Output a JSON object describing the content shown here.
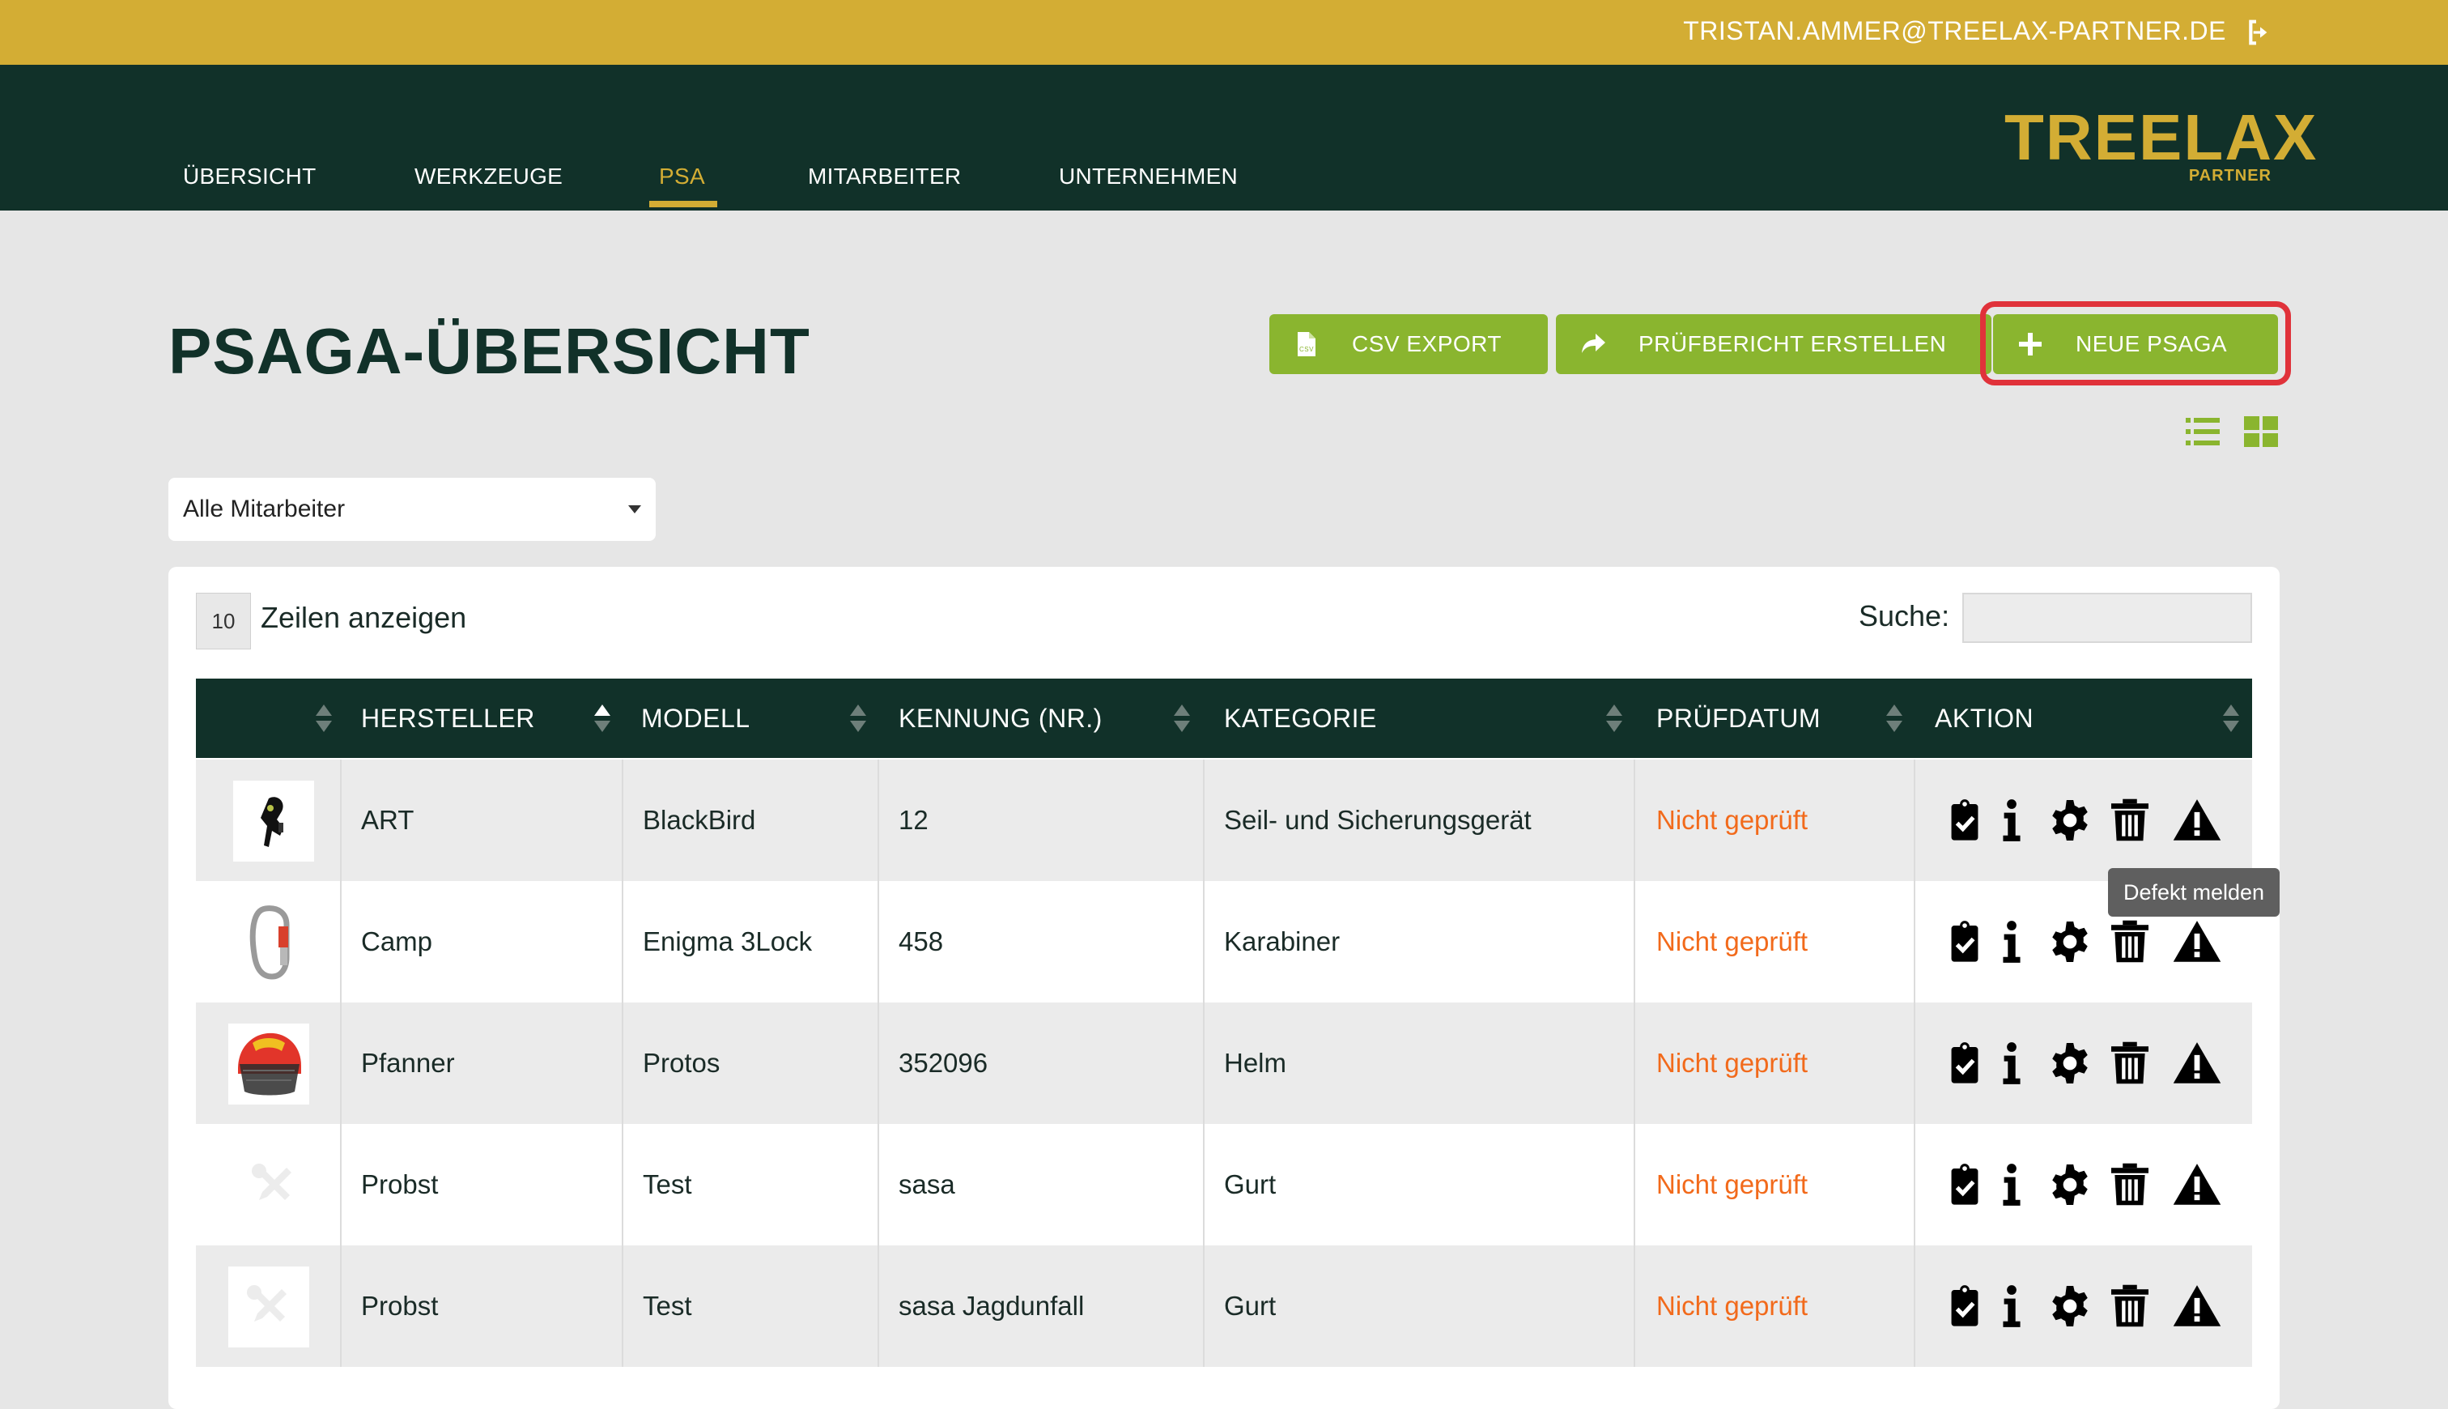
{
  "topbar": {
    "email": "TRISTAN.AMMER@TREELAX-PARTNER.DE",
    "logout_icon": "logout-icon"
  },
  "logo": {
    "word": "TREELAX",
    "sub": "PARTNER"
  },
  "nav": {
    "items": [
      {
        "label": "ÜBERSICHT",
        "active": false
      },
      {
        "label": "WERKZEUGE",
        "active": false
      },
      {
        "label": "PSA",
        "active": true
      },
      {
        "label": "MITARBEITER",
        "active": false
      },
      {
        "label": "UNTERNEHMEN",
        "active": false
      }
    ]
  },
  "page": {
    "title": "PSAGA-ÜBERSICHT"
  },
  "toolbar": {
    "csv_label": "CSV EXPORT",
    "report_label": "PRÜFBERICHT ERSTELLEN",
    "new_label": "NEUE PSAGA",
    "accent": "#8ab52f"
  },
  "filter": {
    "employee_selected": "Alle Mitarbeiter"
  },
  "table_controls": {
    "rows_value": "10",
    "rows_label": "Zeilen anzeigen",
    "search_label": "Suche:",
    "search_value": ""
  },
  "table": {
    "headers": [
      "HERSTELLER",
      "MODELL",
      "KENNUNG (NR.)",
      "KATEGORIE",
      "PRÜFDATUM",
      "AKTION"
    ],
    "rows": [
      {
        "hersteller": "ART",
        "modell": "BlackBird",
        "kennung": "12",
        "kategorie": "Seil- und Sicherungsgerät",
        "pruefdatum": "Nicht geprüft",
        "image": "rope-device"
      },
      {
        "hersteller": "Camp",
        "modell": "Enigma 3Lock",
        "kennung": "458",
        "kategorie": "Karabiner",
        "pruefdatum": "Nicht geprüft",
        "image": "carabiner"
      },
      {
        "hersteller": "Pfanner",
        "modell": "Protos",
        "kennung": "352096",
        "kategorie": "Helm",
        "pruefdatum": "Nicht geprüft",
        "image": "helmet"
      },
      {
        "hersteller": "Probst",
        "modell": "Test",
        "kennung": "sasa",
        "kategorie": "Gurt",
        "pruefdatum": "Nicht geprüft",
        "image": "placeholder-tools"
      },
      {
        "hersteller": "Probst",
        "modell": "Test",
        "kennung": "sasa Jagdunfall",
        "kategorie": "Gurt",
        "pruefdatum": "Nicht geprüft",
        "image": "placeholder-tools"
      }
    ],
    "status_color": "#f26a1b"
  },
  "tooltip": {
    "text": "Defekt melden"
  },
  "colors": {
    "gold": "#d3ad34",
    "dark_green": "#113129",
    "highlight": "#e0323a"
  }
}
